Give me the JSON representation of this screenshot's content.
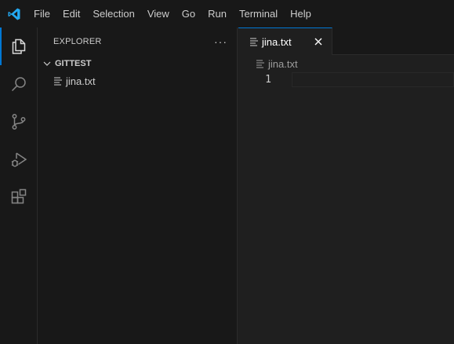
{
  "menu": {
    "items": [
      "File",
      "Edit",
      "Selection",
      "View",
      "Go",
      "Run",
      "Terminal",
      "Help"
    ]
  },
  "activity_bar": {
    "items": [
      {
        "name": "explorer",
        "icon": "files-icon",
        "active": true
      },
      {
        "name": "search",
        "icon": "search-icon",
        "active": false
      },
      {
        "name": "source-control",
        "icon": "source-control-icon",
        "active": false
      },
      {
        "name": "run-and-debug",
        "icon": "run-debug-icon",
        "active": false
      },
      {
        "name": "extensions",
        "icon": "extensions-icon",
        "active": false
      }
    ]
  },
  "sidebar": {
    "title": "EXPLORER",
    "more_actions": "···",
    "folder": "GITTEST",
    "files": [
      "jina.txt"
    ]
  },
  "editor": {
    "tab": {
      "label": "jina.txt",
      "close": "×"
    },
    "breadcrumb": "jina.txt",
    "lines": [
      "1"
    ]
  },
  "colors": {
    "accent": "#0078d4",
    "logo": "#23a9f2",
    "background": "#1f1f1f",
    "chrome": "#181818"
  }
}
